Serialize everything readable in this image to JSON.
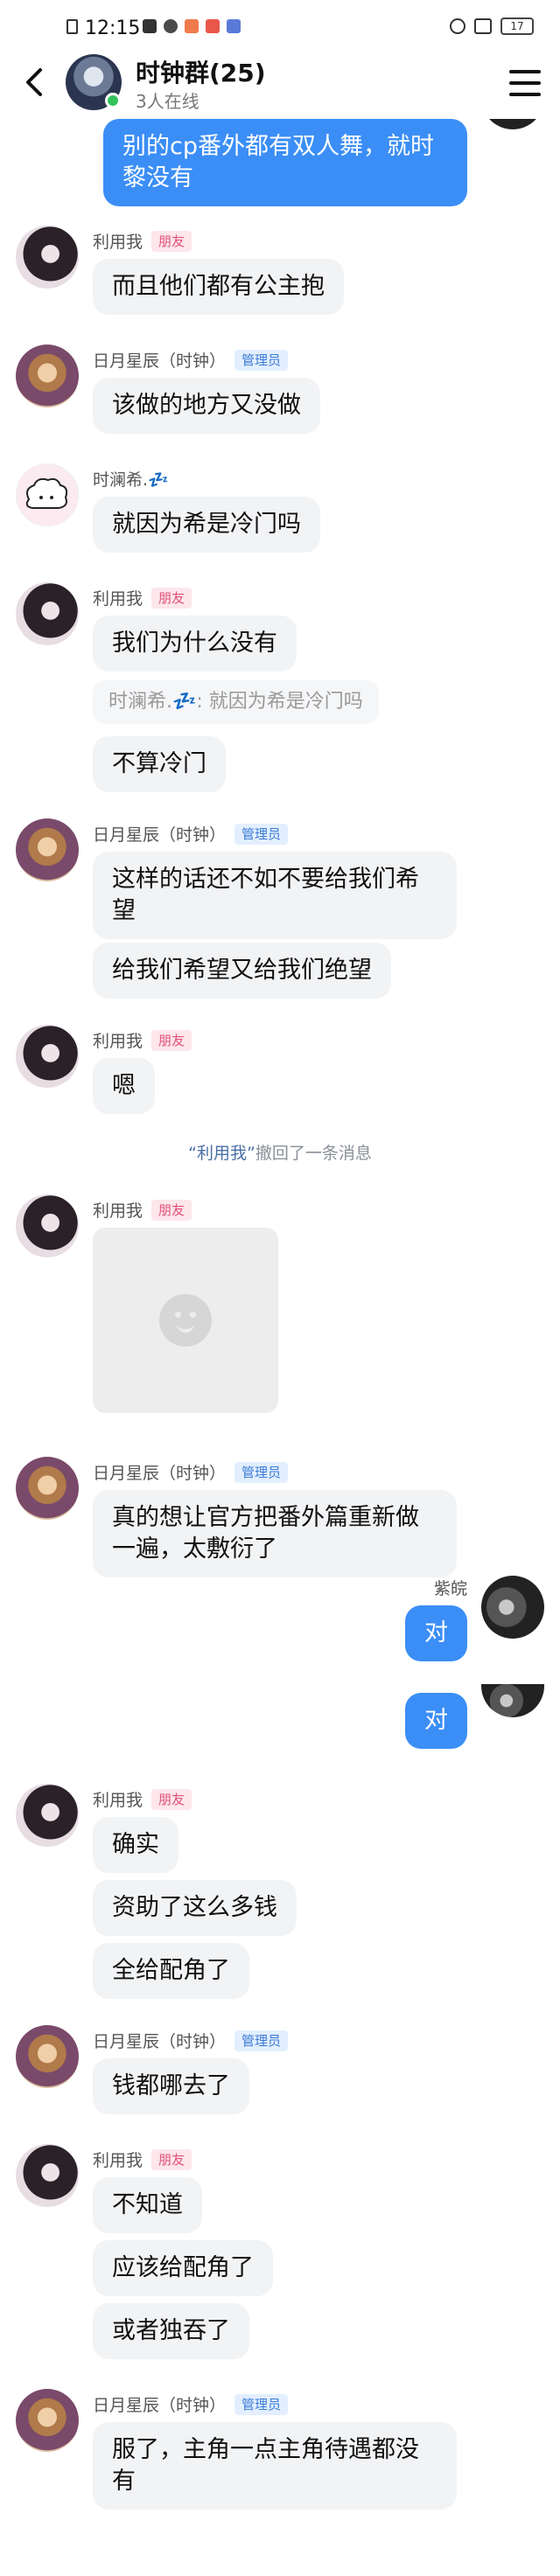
{
  "status_bar": {
    "time": "12:15",
    "battery": "17"
  },
  "header": {
    "back_label": "back",
    "group_name": "时钟群(25)",
    "online": "3人在线"
  },
  "badges": {
    "friend": "朋友",
    "admin": "管理员"
  },
  "senders": {
    "liyong": "利用我",
    "riyue": "日月星辰（时钟）",
    "shilan": "时澜希.💤",
    "self": "紫皖"
  },
  "messages": {
    "m0": "别的cp番外都有双人舞，就时黎没有",
    "m1": "而且他们都有公主抱",
    "m2": "该做的地方又没做",
    "m3": "就因为希是冷门吗",
    "m4a": "我们为什么没有",
    "m4q": "时澜希.💤: 就因为希是冷门吗",
    "m4b": "不算冷门",
    "m5a": "这样的话还不如不要给我们希望",
    "m5b": "给我们希望又给我们绝望",
    "m6": "嗯",
    "recall_name": "“利用我”",
    "recall_text": "撤回了一条消息",
    "m8": "真的想让官方把番外篇重新做一遍，太敷衍了",
    "s1": "对",
    "s2": "对",
    "m9a": "确实",
    "m9b": "资助了这么多钱",
    "m9c": "全给配角了",
    "m10": "钱都哪去了",
    "m11a": "不知道",
    "m11b": "应该给配角了",
    "m11c": "或者独吞了",
    "m12": "服了，主角一点主角待遇都没有"
  },
  "colors": {
    "self_bubble": "#3b8ef6",
    "other_bubble": "#f2f3f5",
    "friend_badge": "#e0527a",
    "admin_badge": "#3a7bd5",
    "online_dot": "#33c25a"
  }
}
